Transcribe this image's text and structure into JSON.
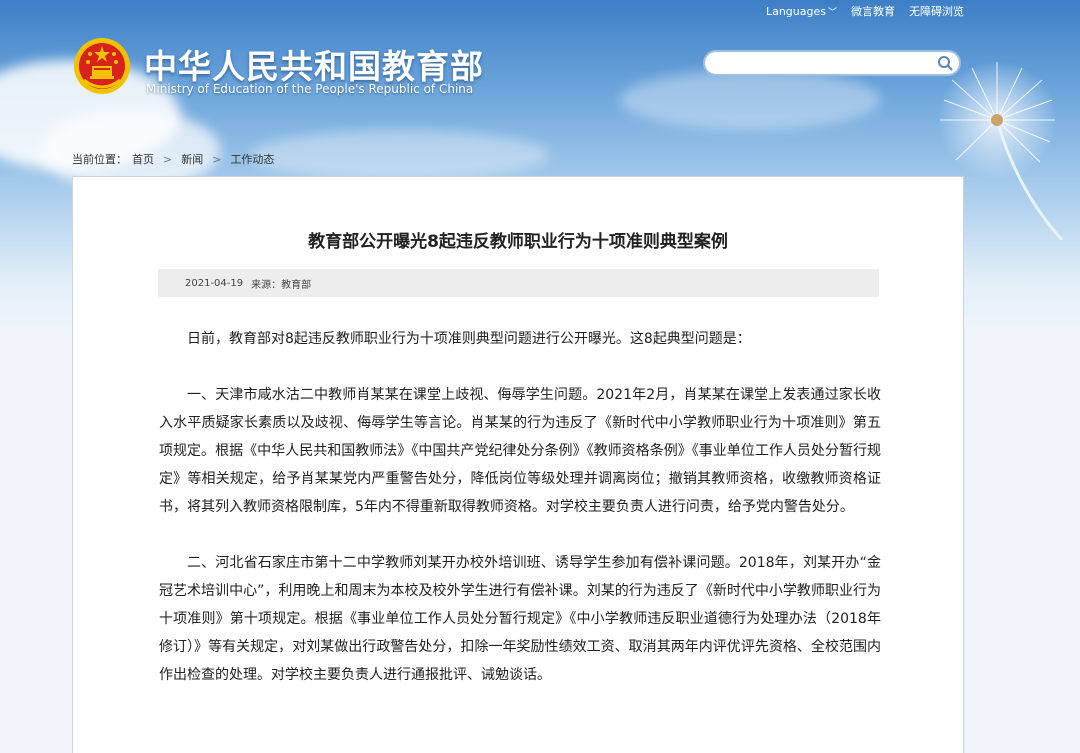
{
  "header": {
    "languages_label": "Languages",
    "wechat_label": "微言教育",
    "accessibility_label": "无障碍浏览",
    "title_cn": "中华人民共和国教育部",
    "title_en": "Ministry of Education of the People's Republic of China"
  },
  "search": {
    "placeholder": "",
    "value": ""
  },
  "breadcrumb": {
    "prefix": "当前位置：",
    "items": [
      "首页",
      "新闻",
      "工作动态"
    ]
  },
  "article": {
    "title": "教育部公开曝光8起违反教师职业行为十项准则典型案例",
    "date": "2021-04-19",
    "source": "来源：教育部",
    "paragraphs": [
      "日前，教育部对8起违反教师职业行为十项准则典型问题进行公开曝光。这8起典型问题是：",
      "一、天津市咸水沽二中教师肖某某在课堂上歧视、侮辱学生问题。2021年2月，肖某某在课堂上发表通过家长收入水平质疑家长素质以及歧视、侮辱学生等言论。肖某某的行为违反了《新时代中小学教师职业行为十项准则》第五项规定。根据《中华人民共和国教师法》《中国共产党纪律处分条例》《教师资格条例》《事业单位工作人员处分暂行规定》等相关规定，给予肖某某党内严重警告处分，降低岗位等级处理并调离岗位；撤销其教师资格，收缴教师资格证书，将其列入教师资格限制库，5年内不得重新取得教师资格。对学校主要负责人进行问责，给予党内警告处分。",
      "二、河北省石家庄市第十二中学教师刘某开办校外培训班、诱导学生参加有偿补课问题。2018年，刘某开办“金冠艺术培训中心”，利用晚上和周末为本校及校外学生进行有偿补课。刘某的行为违反了《新时代中小学教师职业行为十项准则》第十项规定。根据《事业单位工作人员处分暂行规定》《中小学教师违反职业道德行为处理办法（2018年修订）》等有关规定，对刘某做出行政警告处分，扣除一年奖励性绩效工资、取消其两年内评优评先资格、全校范围内作出检查的处理。对学校主要负责人进行通报批评、诫勉谈话。"
    ]
  },
  "colors": {
    "sky_top": "#3d7fc6",
    "emblem_red": "#d7231c",
    "emblem_gold": "#f2c200"
  }
}
